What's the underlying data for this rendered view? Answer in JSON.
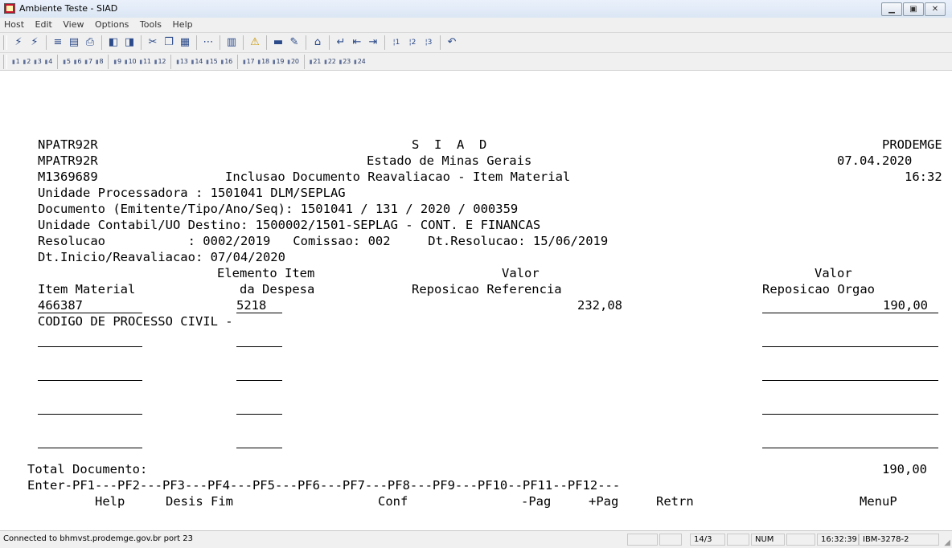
{
  "window": {
    "title": "Ambiente Teste - SIAD",
    "controls": [
      "minimize-icon",
      "maximize-icon",
      "close-icon"
    ]
  },
  "menu": [
    "Host",
    "Edit",
    "View",
    "Options",
    "Tools",
    "Help"
  ],
  "toolbar_icons": [
    "connect-icon",
    "disconnect-icon",
    "send-icon",
    "receive-icon",
    "print-icon",
    "copy-screen-icon",
    "paste-screen-icon",
    "cut-icon",
    "copy-icon",
    "paste-icon",
    "select-icon",
    "graph-icon",
    "alert-icon",
    "keyboard-icon",
    "edit-icon",
    "home-icon",
    "enter-icon",
    "tab-back-icon",
    "tab-forward-icon",
    "pa1-icon",
    "pa2-icon",
    "pa3-icon",
    "undo-icon"
  ],
  "pf_keys": [
    "1",
    "2",
    "3",
    "4",
    "5",
    "6",
    "7",
    "8",
    "9",
    "10",
    "11",
    "12",
    "13",
    "14",
    "15",
    "16",
    "17",
    "18",
    "19",
    "20",
    "21",
    "22",
    "23",
    "24"
  ],
  "screen": {
    "r1": {
      "a": "NPATR92R",
      "b": "S  I  A  D",
      "c": "PRODEMGE"
    },
    "r2": {
      "a": "MPATR92R",
      "b": "Estado de Minas Gerais",
      "c": "07.04.2020"
    },
    "r3": {
      "a": "M1369689",
      "b": "Inclusao Documento Reavaliacao - Item Material",
      "c": "16:32"
    },
    "r4": "Unidade Processadora : 1501041 DLM/SEPLAG",
    "r5": "Documento (Emitente/Tipo/Ano/Seq): 1501041 / 131 / 2020 / 000359",
    "r6": "Unidade Contabil/UO Destino: 1500002/1501-SEPLAG - CONT. E FINANCAS",
    "r7": "Resolucao           : 0002/2019   Comissao: 002     Dt.Resolucao: 15/06/2019",
    "r8": "Dt.Inicio/Reavaliacao: 07/04/2020",
    "h1": {
      "a": "Elemento Item",
      "b": "Valor",
      "c": "Valor"
    },
    "h2": {
      "a": "Item Material",
      "b": "da Despesa",
      "c": "Reposicao Referencia",
      "d": "Reposicao Orgao"
    },
    "item": {
      "material": "466387",
      "elemento": "5218",
      "valor_ref": "232,08",
      "valor_orgao": "190,00"
    },
    "descricao": "CODIGO DE PROCESSO CIVIL -",
    "total_label": "Total Documento:",
    "total_value": "190,00",
    "pf_line": "Enter-PF1---PF2---PF3---PF4---PF5---PF6---PF7---PF8---PF9---PF10--PF11--PF12---",
    "pf_labels": {
      "pf1": "Help",
      "pf2": "Desis",
      "pf3": "Fim",
      "pf5": "Conf",
      "pf7": "-Pag",
      "pf8": "+Pag",
      "pf9": "Retrn",
      "pf12": "MenuP"
    }
  },
  "status": {
    "connection": "Connected to bhmvst.prodemge.gov.br port 23",
    "cursor": "14/3",
    "num": "NUM",
    "time": "16:32:39",
    "terminal_type": "IBM-3278-2"
  }
}
